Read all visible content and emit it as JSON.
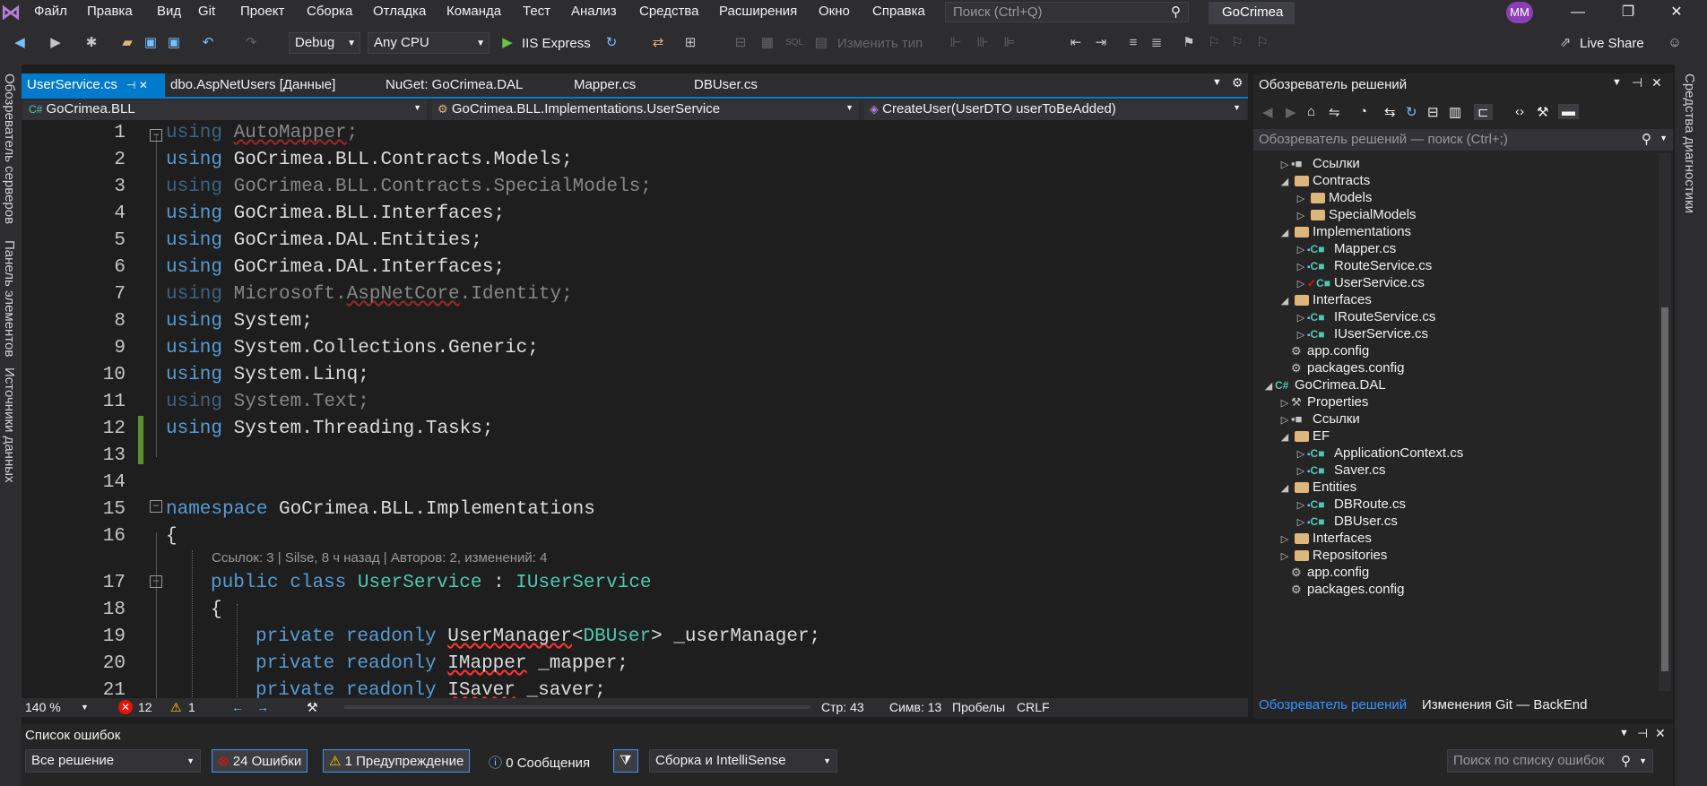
{
  "menu": {
    "items": [
      "Файл",
      "Правка",
      "Вид",
      "Git",
      "Проект",
      "Сборка",
      "Отладка",
      "Команда",
      "Тест",
      "Анализ",
      "Средства",
      "Расширения",
      "Окно",
      "Справка"
    ],
    "search_placeholder": "Поиск (Ctrl+Q)",
    "solution_title": "GoCrimea",
    "avatar_initials": "MM"
  },
  "toolbar": {
    "config": "Debug",
    "platform": "Any CPU",
    "run_target": "IIS Express",
    "change_type": "Изменить тип",
    "live_share": "Live Share"
  },
  "left_strip": {
    "labels": [
      "Обозреватель серверов",
      "Панель элементов",
      "Источники данных"
    ]
  },
  "right_strip": {
    "label": "Средства диагностики"
  },
  "doc_tabs": [
    {
      "label": "UserService.cs",
      "pin": "⊣ ✕"
    },
    {
      "label": "dbo.AspNetUsers [Данные]"
    },
    {
      "label": "NuGet: GoCrimea.DAL"
    },
    {
      "label": "Mapper.cs"
    },
    {
      "label": "DBUser.cs"
    }
  ],
  "nav": {
    "project": "GoCrimea.BLL",
    "type": "GoCrimea.BLL.Implementations.UserService",
    "member": "CreateUser(UserDTO userToBeAdded)"
  },
  "code_lines": [
    {
      "n": "1",
      "text": "using AutoMapper;"
    },
    {
      "n": "2",
      "text": "using GoCrimea.BLL.Contracts.Models;"
    },
    {
      "n": "3",
      "text": "using GoCrimea.BLL.Contracts.SpecialModels;"
    },
    {
      "n": "4",
      "text": "using GoCrimea.BLL.Interfaces;"
    },
    {
      "n": "5",
      "text": "using GoCrimea.DAL.Entities;"
    },
    {
      "n": "6",
      "text": "using GoCrimea.DAL.Interfaces;"
    },
    {
      "n": "7",
      "text": "using Microsoft.AspNetCore.Identity;"
    },
    {
      "n": "8",
      "text": "using System;"
    },
    {
      "n": "9",
      "text": "using System.Collections.Generic;"
    },
    {
      "n": "10",
      "text": "using System.Linq;"
    },
    {
      "n": "11",
      "text": "using System.Text;"
    },
    {
      "n": "12",
      "text": "using System.Threading.Tasks;"
    },
    {
      "n": "13",
      "text": ""
    },
    {
      "n": "14",
      "text": ""
    },
    {
      "n": "15",
      "text": "namespace GoCrimea.BLL.Implementations"
    },
    {
      "n": "16",
      "text": "{"
    },
    {
      "n": "17",
      "text": "public class UserService : IUserService"
    },
    {
      "n": "18",
      "text": "{"
    },
    {
      "n": "19",
      "text": "private readonly UserManager<DBUser> _userManager;"
    },
    {
      "n": "20",
      "text": "private readonly IMapper _mapper;"
    },
    {
      "n": "21",
      "text": "private readonly ISaver _saver;"
    }
  ],
  "codelens": "Ссылок: 3 | Silse, 8 ч назад | Авторов: 2, изменений: 4",
  "status": {
    "zoom": "140 %",
    "errors": "12",
    "warnings": "1",
    "line": "Стр: 43",
    "col": "Симв: 13",
    "spaces": "Пробелы",
    "eol": "CRLF"
  },
  "solution_explorer": {
    "title": "Обозреватель решений",
    "search_placeholder": "Обозреватель решений — поиск (Ctrl+;)",
    "items": [
      {
        "label": "Ссылки",
        "kind": "ref",
        "indent": 1,
        "exp": "▷"
      },
      {
        "label": "Contracts",
        "kind": "folder-open",
        "indent": 1,
        "exp": "◢"
      },
      {
        "label": "Models",
        "kind": "folder",
        "indent": 2,
        "exp": "▷"
      },
      {
        "label": "SpecialModels",
        "kind": "folder",
        "indent": 2,
        "exp": "▷"
      },
      {
        "label": "Implementations",
        "kind": "folder-open",
        "indent": 1,
        "exp": "◢"
      },
      {
        "label": "Mapper.cs",
        "kind": "cs",
        "indent": 2,
        "exp": "▷"
      },
      {
        "label": "RouteService.cs",
        "kind": "cs",
        "indent": 2,
        "exp": "▷"
      },
      {
        "label": "UserService.cs",
        "kind": "cs-mod",
        "indent": 2,
        "exp": "▷"
      },
      {
        "label": "Interfaces",
        "kind": "folder-open",
        "indent": 1,
        "exp": "◢"
      },
      {
        "label": "IRouteService.cs",
        "kind": "cs",
        "indent": 2,
        "exp": "▷"
      },
      {
        "label": "IUserService.cs",
        "kind": "cs",
        "indent": 2,
        "exp": "▷"
      },
      {
        "label": "app.config",
        "kind": "cfg",
        "indent": 1,
        "exp": ""
      },
      {
        "label": "packages.config",
        "kind": "cfg",
        "indent": 1,
        "exp": ""
      },
      {
        "label": "GoCrimea.DAL",
        "kind": "proj",
        "indent": 0,
        "exp": "◢"
      },
      {
        "label": "Properties",
        "kind": "wrench",
        "indent": 1,
        "exp": "▷"
      },
      {
        "label": "Ссылки",
        "kind": "ref",
        "indent": 1,
        "exp": "▷"
      },
      {
        "label": "EF",
        "kind": "folder-open",
        "indent": 1,
        "exp": "◢"
      },
      {
        "label": "ApplicationContext.cs",
        "kind": "cs",
        "indent": 2,
        "exp": "▷"
      },
      {
        "label": "Saver.cs",
        "kind": "cs",
        "indent": 2,
        "exp": "▷"
      },
      {
        "label": "Entities",
        "kind": "folder-open",
        "indent": 1,
        "exp": "◢"
      },
      {
        "label": "DBRoute.cs",
        "kind": "cs",
        "indent": 2,
        "exp": "▷"
      },
      {
        "label": "DBUser.cs",
        "kind": "cs",
        "indent": 2,
        "exp": "▷"
      },
      {
        "label": "Interfaces",
        "kind": "folder",
        "indent": 1,
        "exp": "▷"
      },
      {
        "label": "Repositories",
        "kind": "folder",
        "indent": 1,
        "exp": "▷"
      },
      {
        "label": "app.config",
        "kind": "cfg",
        "indent": 1,
        "exp": ""
      },
      {
        "label": "packages.config",
        "kind": "cfg",
        "indent": 1,
        "exp": ""
      }
    ],
    "tab_solution": "Обозреватель решений",
    "tab_git": "Изменения Git — BackEnd"
  },
  "error_list": {
    "title": "Список ошибок",
    "scope": "Все решение",
    "errors": "24 Ошибки",
    "warnings": "1 Предупреждение",
    "messages": "0 Сообщения",
    "source": "Сборка и IntelliSense",
    "search_placeholder": "Поиск по списку ошибок"
  },
  "colors": {
    "accent": "#007acc",
    "keyword": "#569cd6",
    "type": "#4ec9b0",
    "error": "#e51400"
  }
}
